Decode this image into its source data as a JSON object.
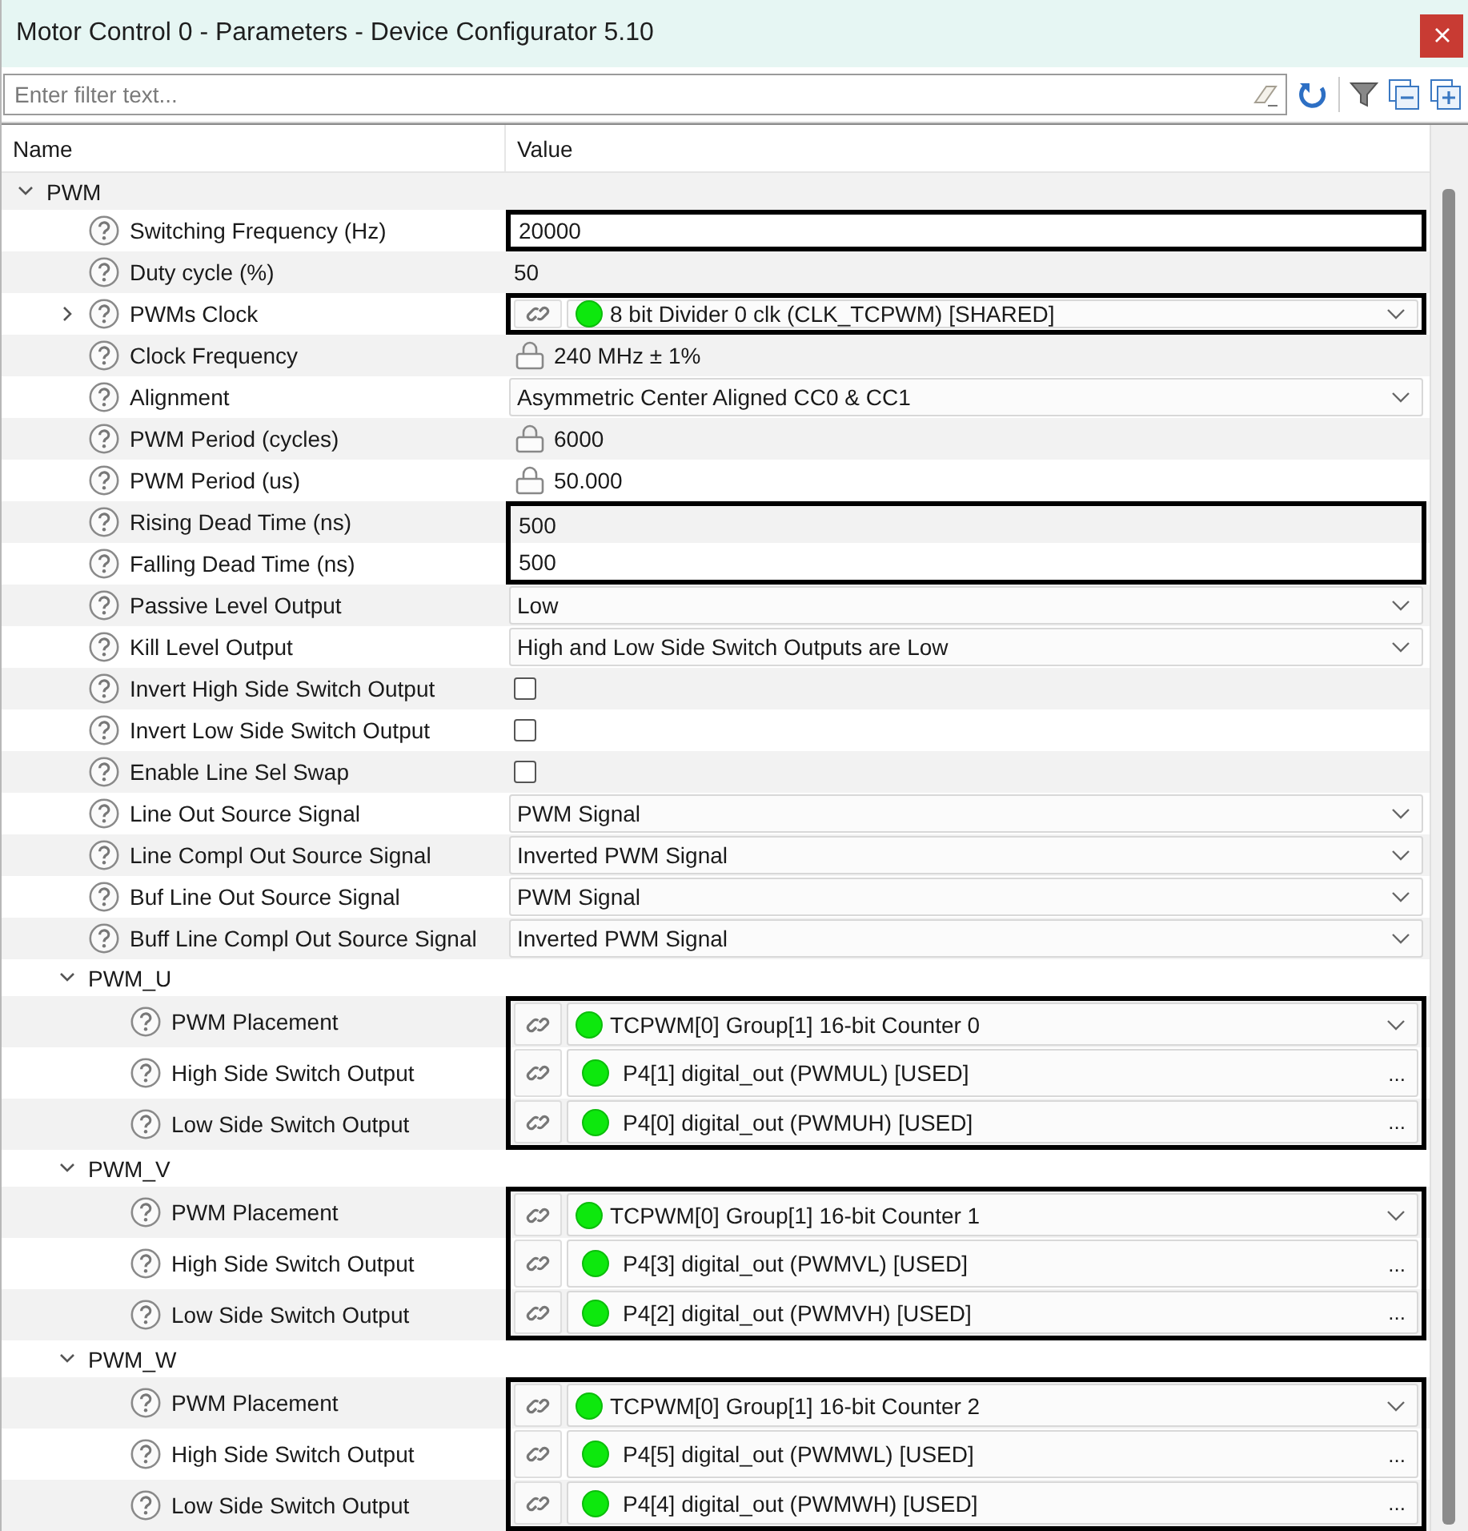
{
  "window": {
    "title": "Motor Control 0 - Parameters - Device Configurator 5.10"
  },
  "filter": {
    "placeholder": "Enter filter text..."
  },
  "columns": [
    "Name",
    "Value"
  ],
  "tree": [
    {
      "label": "PWM",
      "expanded": true,
      "children": [
        {
          "label": "Switching Frequency (Hz)",
          "kind": "input",
          "value": "20000",
          "highlighted": true
        },
        {
          "label": "Duty cycle (%)",
          "kind": "text",
          "value": "50",
          "highlighted": false
        },
        {
          "label": "PWMs Clock",
          "kind": "link-dropdown",
          "value": "8 bit Divider 0 clk (CLK_TCPWM) [SHARED]",
          "expanded": false,
          "highlighted": true
        },
        {
          "label": "Clock Frequency",
          "kind": "readonly",
          "value": "240 MHz ± 1%",
          "highlighted": false
        },
        {
          "label": "Alignment",
          "kind": "dropdown",
          "value": "Asymmetric Center Aligned CC0 & CC1",
          "highlighted": false
        },
        {
          "label": "PWM Period (cycles)",
          "kind": "readonly",
          "value": "6000",
          "highlighted": false
        },
        {
          "label": "PWM Period (us)",
          "kind": "readonly",
          "value": "50.000",
          "highlighted": false
        },
        {
          "label": "Rising Dead Time (ns)",
          "kind": "input",
          "value": "500",
          "highlighted": true
        },
        {
          "label": "Falling Dead Time (ns)",
          "kind": "input",
          "value": "500",
          "highlighted": true
        },
        {
          "label": "Passive Level Output",
          "kind": "dropdown",
          "value": "Low",
          "highlighted": false
        },
        {
          "label": "Kill Level Output",
          "kind": "dropdown",
          "value": "High and Low Side Switch Outputs are Low",
          "highlighted": false
        },
        {
          "label": "Invert High Side Switch Output",
          "kind": "checkbox",
          "checked": false,
          "highlighted": false
        },
        {
          "label": "Invert Low Side Switch Output",
          "kind": "checkbox",
          "checked": false,
          "highlighted": false
        },
        {
          "label": "Enable Line Sel Swap",
          "kind": "checkbox",
          "checked": false,
          "highlighted": false
        },
        {
          "label": "Line Out Source Signal",
          "kind": "dropdown",
          "value": "PWM Signal",
          "highlighted": false
        },
        {
          "label": "Line Compl Out Source Signal",
          "kind": "dropdown",
          "value": "Inverted PWM Signal",
          "highlighted": false
        },
        {
          "label": "Buf Line Out Source Signal",
          "kind": "dropdown",
          "value": "PWM Signal",
          "highlighted": false
        },
        {
          "label": "Buff Line Compl Out Source Signal",
          "kind": "dropdown",
          "value": "Inverted PWM Signal",
          "highlighted": false
        },
        {
          "label": "PWM_U",
          "expanded": true,
          "children": [
            {
              "label": "PWM Placement",
              "kind": "link-dropdown",
              "value": "TCPWM[0] Group[1] 16-bit Counter 0",
              "highlighted": true
            },
            {
              "label": "High Side Switch Output",
              "kind": "link-browse",
              "value": "P4[1] digital_out (PWMUL) [USED]",
              "button": "...",
              "highlighted": true
            },
            {
              "label": "Low Side Switch Output",
              "kind": "link-browse",
              "value": "P4[0] digital_out (PWMUH) [USED]",
              "button": "...",
              "highlighted": true
            }
          ]
        },
        {
          "label": "PWM_V",
          "expanded": true,
          "children": [
            {
              "label": "PWM Placement",
              "kind": "link-dropdown",
              "value": "TCPWM[0] Group[1] 16-bit Counter 1",
              "highlighted": true
            },
            {
              "label": "High Side Switch Output",
              "kind": "link-browse",
              "value": "P4[3] digital_out (PWMVL) [USED]",
              "button": "...",
              "highlighted": true
            },
            {
              "label": "Low Side Switch Output",
              "kind": "link-browse",
              "value": "P4[2] digital_out (PWMVH) [USED]",
              "button": "...",
              "highlighted": true
            }
          ]
        },
        {
          "label": "PWM_W",
          "expanded": true,
          "children": [
            {
              "label": "PWM Placement",
              "kind": "link-dropdown",
              "value": "TCPWM[0] Group[1] 16-bit Counter 2",
              "highlighted": true
            },
            {
              "label": "High Side Switch Output",
              "kind": "link-browse",
              "value": "P4[5] digital_out (PWMWL) [USED]",
              "button": "...",
              "highlighted": true
            },
            {
              "label": "Low Side Switch Output",
              "kind": "link-browse",
              "value": "P4[4] digital_out (PWMWH) [USED]",
              "button": "...",
              "highlighted": true
            }
          ]
        }
      ]
    }
  ]
}
